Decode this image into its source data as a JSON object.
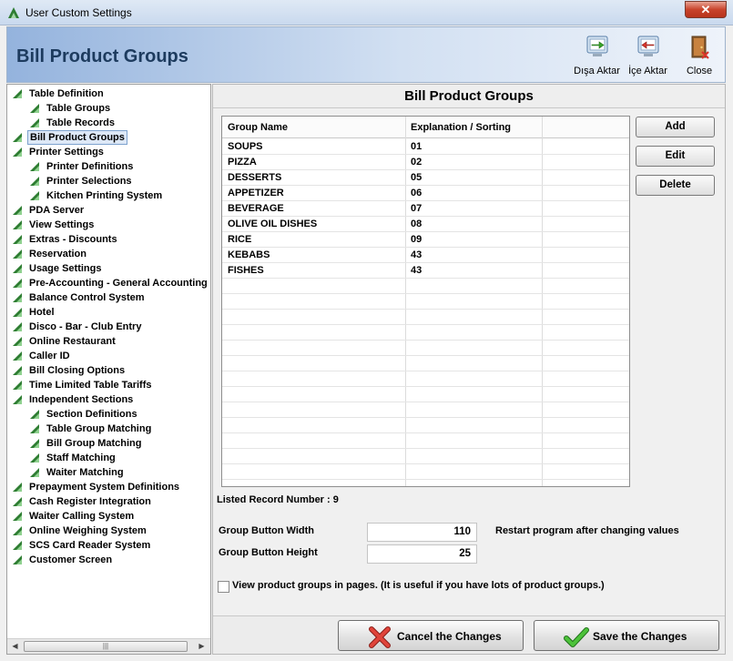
{
  "window": {
    "title": "User Custom Settings",
    "close_label": "✕"
  },
  "header": {
    "title": "Bill Product Groups",
    "toolbar": [
      {
        "label": "Dışa Aktar",
        "icon": "export-icon"
      },
      {
        "label": "İçe Aktar",
        "icon": "import-icon"
      },
      {
        "label": "Close",
        "icon": "door-close-icon"
      }
    ]
  },
  "tree": [
    {
      "label": "Table Definition",
      "level": 0
    },
    {
      "label": "Table Groups",
      "level": 1
    },
    {
      "label": "Table Records",
      "level": 1
    },
    {
      "label": "Bill Product Groups",
      "level": 0,
      "selected": true
    },
    {
      "label": "Printer Settings",
      "level": 0
    },
    {
      "label": "Printer Definitions",
      "level": 1
    },
    {
      "label": "Printer Selections",
      "level": 1
    },
    {
      "label": "Kitchen Printing System",
      "level": 1
    },
    {
      "label": "PDA Server",
      "level": 0
    },
    {
      "label": "View Settings",
      "level": 0
    },
    {
      "label": "Extras - Discounts",
      "level": 0
    },
    {
      "label": "Reservation",
      "level": 0
    },
    {
      "label": "Usage Settings",
      "level": 0
    },
    {
      "label": "Pre-Accounting - General Accounting",
      "level": 0
    },
    {
      "label": "Balance Control System",
      "level": 0
    },
    {
      "label": "Hotel",
      "level": 0
    },
    {
      "label": "Disco - Bar - Club Entry",
      "level": 0
    },
    {
      "label": "Online Restaurant",
      "level": 0
    },
    {
      "label": "Caller ID",
      "level": 0
    },
    {
      "label": "Bill Closing Options",
      "level": 0
    },
    {
      "label": "Time Limited Table Tariffs",
      "level": 0
    },
    {
      "label": "Independent Sections",
      "level": 0
    },
    {
      "label": "Section Definitions",
      "level": 1
    },
    {
      "label": "Table Group Matching",
      "level": 1
    },
    {
      "label": "Bill Group Matching",
      "level": 1
    },
    {
      "label": "Staff Matching",
      "level": 1
    },
    {
      "label": "Waiter Matching",
      "level": 1
    },
    {
      "label": "Prepayment System Definitions",
      "level": 0
    },
    {
      "label": "Cash Register Integration",
      "level": 0
    },
    {
      "label": "Waiter Calling System",
      "level": 0
    },
    {
      "label": "Online Weighing System",
      "level": 0
    },
    {
      "label": "SCS Card Reader System",
      "level": 0
    },
    {
      "label": "Customer Screen",
      "level": 0
    }
  ],
  "tree_scroll": {
    "left_arrow": "◀",
    "right_arrow": "▶",
    "thumb_grip": "|||"
  },
  "panel": {
    "title": "Bill Product Groups",
    "columns": [
      "Group Name",
      "Explanation / Sorting"
    ],
    "rows": [
      [
        "SOUPS",
        "01"
      ],
      [
        "PIZZA",
        "02"
      ],
      [
        "DESSERTS",
        "05"
      ],
      [
        "APPETIZER",
        "06"
      ],
      [
        "BEVERAGE",
        "07"
      ],
      [
        "OLIVE OIL DISHES",
        "08"
      ],
      [
        "RICE",
        "09"
      ],
      [
        "KEBABS",
        "43"
      ],
      [
        "FISHES",
        "43"
      ]
    ],
    "buttons": {
      "add": "Add",
      "edit": "Edit",
      "delete": "Delete"
    },
    "record_count_label": "Listed Record Number : 9",
    "width_label": "Group Button Width",
    "width_value": "110",
    "height_label": "Group Button Height",
    "height_value": "25",
    "restart_note": "Restart program after changing values",
    "pages_checkbox_label": "View product groups in pages. (It is useful if you have lots of product groups.)",
    "pages_checked": false,
    "cancel_label": "Cancel the Changes",
    "save_label": "Save the Changes"
  },
  "colors": {
    "tree_icon": "#2e7d32",
    "close_button": "#c8432b",
    "cancel_x": "#d9342b",
    "save_check": "#3aa52a",
    "header_title": "#1d3b5e"
  }
}
